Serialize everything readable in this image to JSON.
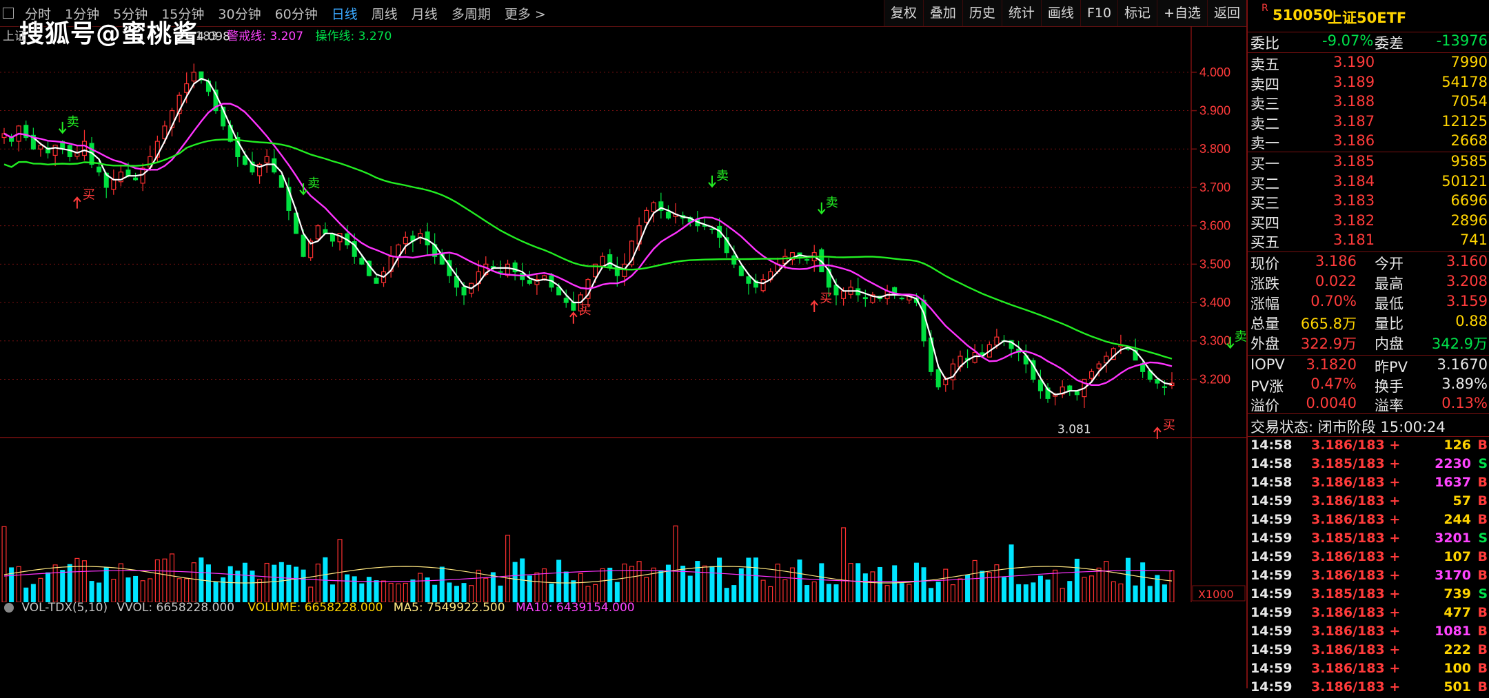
{
  "toolbar": {
    "periods": [
      "分时",
      "1分钟",
      "5分钟",
      "15分钟",
      "30分钟",
      "60分钟",
      "日线",
      "周线",
      "月线",
      "多周期",
      "更多 >"
    ],
    "active_period": "日线",
    "tools": [
      "复权",
      "叠加",
      "历史",
      "统计",
      "画线",
      "F10",
      "标记",
      "+自选",
      "返回"
    ]
  },
  "watermark": "搜狐号@蜜桃酱",
  "legend": {
    "prefix": "上证",
    "ma_value": "183",
    "warn_label": "警戒线: 3.207",
    "op_label": "操作线: 3.270"
  },
  "chart_labels": {
    "high": "4.098",
    "low": "3.081",
    "sell": "卖",
    "buy": "买"
  },
  "volume_legend": {
    "name": "VOL-TDX(5,10)",
    "vvol": "VVOL: 6658228.000",
    "volume": "VOLUME: 6658228.000",
    "ma5": "MA5: 7549922.500",
    "ma10": "MA10: 6439154.000",
    "unit": "X1000",
    "tick": "10000"
  },
  "chart_data": {
    "type": "line",
    "y_ticks": [
      "4.000",
      "3.900",
      "3.800",
      "3.700",
      "3.600",
      "3.500",
      "3.400",
      "3.300",
      "3.200"
    ],
    "ylim": [
      3.05,
      4.12
    ],
    "close": [
      3.84,
      3.82,
      3.86,
      3.83,
      3.8,
      3.81,
      3.79,
      3.81,
      3.8,
      3.78,
      3.79,
      3.82,
      3.76,
      3.74,
      3.7,
      3.72,
      3.74,
      3.73,
      3.72,
      3.75,
      3.78,
      3.82,
      3.86,
      3.9,
      3.94,
      3.97,
      4.0,
      3.98,
      3.95,
      3.9,
      3.86,
      3.82,
      3.78,
      3.76,
      3.74,
      3.76,
      3.78,
      3.74,
      3.7,
      3.64,
      3.58,
      3.52,
      3.56,
      3.6,
      3.58,
      3.56,
      3.58,
      3.55,
      3.52,
      3.5,
      3.47,
      3.45,
      3.48,
      3.52,
      3.55,
      3.57,
      3.56,
      3.58,
      3.55,
      3.52,
      3.5,
      3.47,
      3.44,
      3.42,
      3.45,
      3.48,
      3.5,
      3.49,
      3.48,
      3.5,
      3.48,
      3.46,
      3.45,
      3.46,
      3.47,
      3.44,
      3.42,
      3.4,
      3.38,
      3.42,
      3.46,
      3.5,
      3.52,
      3.49,
      3.47,
      3.5,
      3.56,
      3.6,
      3.64,
      3.66,
      3.64,
      3.62,
      3.63,
      3.62,
      3.61,
      3.6,
      3.6,
      3.59,
      3.57,
      3.53,
      3.5,
      3.47,
      3.45,
      3.44,
      3.46,
      3.48,
      3.5,
      3.52,
      3.53,
      3.52,
      3.51,
      3.53,
      3.48,
      3.44,
      3.42,
      3.43,
      3.44,
      3.42,
      3.41,
      3.42,
      3.41,
      3.43,
      3.42,
      3.41,
      3.42,
      3.4,
      3.3,
      3.22,
      3.18,
      3.2,
      3.24,
      3.26,
      3.25,
      3.27,
      3.26,
      3.29,
      3.31,
      3.3,
      3.28,
      3.27,
      3.24,
      3.2,
      3.17,
      3.15,
      3.16,
      3.18,
      3.17,
      3.16,
      3.2,
      3.22,
      3.24,
      3.26,
      3.28,
      3.29,
      3.28,
      3.25,
      3.22,
      3.2,
      3.19,
      3.18,
      3.19
    ],
    "series": []
  },
  "panel": {
    "code": "510050",
    "name": "上证50ETF",
    "flag": "R",
    "weibi_label": "委比",
    "weibi": "-9.07%",
    "weicha_label": "委差",
    "weicha": "-13976",
    "asks": [
      {
        "label": "卖五",
        "price": "3.190",
        "vol": "7990"
      },
      {
        "label": "卖四",
        "price": "3.189",
        "vol": "54178"
      },
      {
        "label": "卖三",
        "price": "3.188",
        "vol": "7054"
      },
      {
        "label": "卖二",
        "price": "3.187",
        "vol": "12125"
      },
      {
        "label": "卖一",
        "price": "3.186",
        "vol": "2668"
      }
    ],
    "bids": [
      {
        "label": "买一",
        "price": "3.185",
        "vol": "9585"
      },
      {
        "label": "买二",
        "price": "3.184",
        "vol": "50121"
      },
      {
        "label": "买三",
        "price": "3.183",
        "vol": "6696"
      },
      {
        "label": "买四",
        "price": "3.182",
        "vol": "2896"
      },
      {
        "label": "买五",
        "price": "3.181",
        "vol": "741"
      }
    ],
    "stats": [
      {
        "l1": "现价",
        "v1": "3.186",
        "l2": "今开",
        "v2": "3.160",
        "c1": "red",
        "c2": "red"
      },
      {
        "l1": "涨跌",
        "v1": "0.022",
        "l2": "最高",
        "v2": "3.208",
        "c1": "red",
        "c2": "red"
      },
      {
        "l1": "涨幅",
        "v1": "0.70%",
        "l2": "最低",
        "v2": "3.159",
        "c1": "red",
        "c2": "red"
      },
      {
        "l1": "总量",
        "v1": "665.8万",
        "l2": "量比",
        "v2": "0.88",
        "c1": "yellow",
        "c2": "yellow"
      },
      {
        "l1": "外盘",
        "v1": "322.9万",
        "l2": "内盘",
        "v2": "342.9万",
        "c1": "red",
        "c2": "green"
      }
    ],
    "iopv": [
      {
        "l1": "IOPV",
        "v1": "3.1820",
        "l2": "昨PV",
        "v2": "3.1670",
        "c1": "red",
        "c2": "white"
      },
      {
        "l1": "PV涨",
        "v1": "0.47%",
        "l2": "换手",
        "v2": "3.89%",
        "c1": "red",
        "c2": "white"
      },
      {
        "l1": "溢价",
        "v1": "0.0040",
        "l2": "溢率",
        "v2": "0.13%",
        "c1": "red",
        "c2": "red"
      }
    ],
    "status": "交易状态: 闭市阶段 15:00:24",
    "trades": [
      {
        "t": "14:58",
        "p": "3.186/183 +",
        "v": "126",
        "s": "B",
        "vc": "yellow"
      },
      {
        "t": "14:58",
        "p": "3.185/183 +",
        "v": "2230",
        "s": "S",
        "vc": "magenta"
      },
      {
        "t": "14:58",
        "p": "3.186/183 +",
        "v": "1637",
        "s": "B",
        "vc": "magenta"
      },
      {
        "t": "14:59",
        "p": "3.186/183 +",
        "v": "57",
        "s": "B",
        "vc": "yellow"
      },
      {
        "t": "14:59",
        "p": "3.186/183 +",
        "v": "244",
        "s": "B",
        "vc": "yellow"
      },
      {
        "t": "14:59",
        "p": "3.185/183 +",
        "v": "3201",
        "s": "S",
        "vc": "magenta"
      },
      {
        "t": "14:59",
        "p": "3.186/183 +",
        "v": "107",
        "s": "B",
        "vc": "yellow"
      },
      {
        "t": "14:59",
        "p": "3.186/183 +",
        "v": "3170",
        "s": "B",
        "vc": "magenta"
      },
      {
        "t": "14:59",
        "p": "3.185/183 +",
        "v": "739",
        "s": "S",
        "vc": "yellow"
      },
      {
        "t": "14:59",
        "p": "3.186/183 +",
        "v": "477",
        "s": "B",
        "vc": "yellow"
      },
      {
        "t": "14:59",
        "p": "3.186/183 +",
        "v": "1081",
        "s": "B",
        "vc": "magenta"
      },
      {
        "t": "14:59",
        "p": "3.186/183 +",
        "v": "222",
        "s": "B",
        "vc": "yellow"
      },
      {
        "t": "14:59",
        "p": "3.186/183 +",
        "v": "100",
        "s": "B",
        "vc": "yellow"
      },
      {
        "t": "14:59",
        "p": "3.186/183 +",
        "v": "501",
        "s": "B",
        "vc": "yellow"
      }
    ]
  },
  "colors": {
    "up": "#ff3030",
    "down": "#00e040",
    "ma_white": "#ffffff",
    "ma_magenta": "#ff33ff",
    "ma_green": "#22ee22",
    "vol_up": "#ff3030",
    "vol_down": "#00e5ff"
  }
}
